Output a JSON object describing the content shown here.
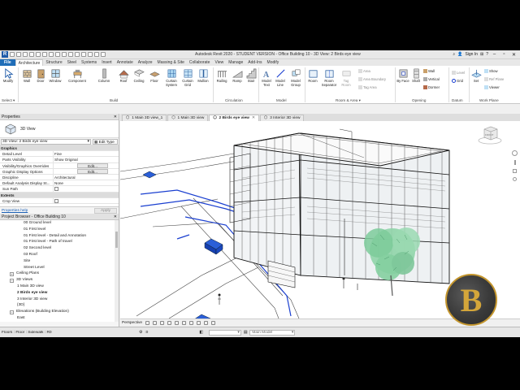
{
  "titlebar": {
    "title": "Autodesk Revit 2020 - STUDENT VERSION - Office Building 10 - 3D View: 2 Birds eye view",
    "sign_in": "Sign In",
    "app_letter": "R"
  },
  "ribbon_tabs": [
    "File",
    "Architecture",
    "Structure",
    "Steel",
    "Systems",
    "Insert",
    "Annotate",
    "Analyze",
    "Massing & Site",
    "Collaborate",
    "View",
    "Manage",
    "Add-Ins",
    "Modify"
  ],
  "ribbon": {
    "modify": "Modify",
    "select": "Select ▾",
    "build": {
      "label": "Build",
      "wall": "Wall",
      "door": "Door",
      "window": "Window",
      "component": "Component",
      "column": "Column",
      "roof": "Roof",
      "ceiling": "Ceiling",
      "floor": "Floor",
      "curtain_system": "Curtain System",
      "curtain_grid": "Curtain Grid",
      "mullion": "Mullion"
    },
    "circulation": {
      "label": "Circulation",
      "railing": "Railing",
      "ramp": "Ramp",
      "stair": "Stair"
    },
    "model": {
      "label": "Model",
      "model_text": "Model Text",
      "model_line": "Model Line",
      "model_group": "Model Group"
    },
    "room_area": {
      "label": "Room & Area ▾",
      "room": "Room",
      "room_separator": "Room Separator",
      "tag_room": "Tag Room",
      "area": "Area",
      "area_boundary": "Area Boundary",
      "tag_area": "Tag Area"
    },
    "opening": {
      "label": "Opening",
      "by_face": "By Face",
      "shaft": "Shaft",
      "wall": "Wall",
      "vertical": "Vertical",
      "dormer": "Dormer"
    },
    "datum": {
      "label": "Datum",
      "level": "Level",
      "grid": "Grid"
    },
    "work_plane": {
      "label": "Work Plane",
      "set": "Set",
      "show": "Show",
      "ref_plane": "Ref Plane",
      "viewer": "Viewer"
    }
  },
  "properties": {
    "header": "Properties",
    "type_name": "3D View",
    "instance": "3D View: 2 Birds eye view",
    "edit_type": "Edit Type",
    "rows": [
      {
        "group": "Graphics"
      },
      {
        "name": "Detail Level",
        "value": "Fine"
      },
      {
        "name": "Parts Visibility",
        "value": "Show Original"
      },
      {
        "name": "Visibility/Graphics Overrides",
        "button": "Edit..."
      },
      {
        "name": "Graphic Display Options",
        "button": "Edit..."
      },
      {
        "name": "Discipline",
        "value": "Architectural"
      },
      {
        "name": "Default Analysis Display St...",
        "value": "None"
      },
      {
        "name": "Sun Path",
        "checkbox": true
      },
      {
        "group": "Extents"
      },
      {
        "name": "Crop View",
        "value": ""
      }
    ],
    "help_link": "Properties help",
    "apply": "Apply"
  },
  "browser": {
    "header": "Project Browser - Office Building 10",
    "nodes": [
      {
        "label": "00 Ground level",
        "depth": 3
      },
      {
        "label": "01 First level",
        "depth": 3
      },
      {
        "label": "01 First level - Detail and Annotation",
        "depth": 3
      },
      {
        "label": "01 First level - Path of travel",
        "depth": 3
      },
      {
        "label": "02 Second level",
        "depth": 3
      },
      {
        "label": "03 Roof",
        "depth": 3
      },
      {
        "label": "Site",
        "depth": 3
      },
      {
        "label": "Street Level",
        "depth": 3
      },
      {
        "label": "Ceiling Plans",
        "depth": 1,
        "toggle": "+"
      },
      {
        "label": "3D Views",
        "depth": 1,
        "toggle": "−"
      },
      {
        "label": "1 Main 3D view",
        "depth": 2
      },
      {
        "label": "2 Birds eye view",
        "depth": 2,
        "selected": true
      },
      {
        "label": "3 Interior 3D view",
        "depth": 2
      },
      {
        "label": "{3D}",
        "depth": 2
      },
      {
        "label": "Elevations (Building Elevation)",
        "depth": 1,
        "toggle": "−"
      },
      {
        "label": "East",
        "depth": 2
      }
    ]
  },
  "view_tabs": [
    {
      "label": "1 Main 3D view_1",
      "active": false
    },
    {
      "label": "1 Main 3D view",
      "active": false
    },
    {
      "label": "2 Birds eye view",
      "active": true
    },
    {
      "label": "3 Interior 3D view",
      "active": false
    }
  ],
  "view_control": {
    "projection": "Perspective"
  },
  "status": {
    "selection": "Floors : Floor : Sidewalk : R0",
    "counter": ":0",
    "workset": "Main Model"
  },
  "viewcube": {
    "label": "FRONT"
  },
  "logo": {
    "letter": "B"
  },
  "colors": {
    "file_tab": "#1f6db8",
    "logo_ring": "#c4962e",
    "tree_green": "#8fd4a8",
    "path_blue": "#1a3fd0"
  }
}
